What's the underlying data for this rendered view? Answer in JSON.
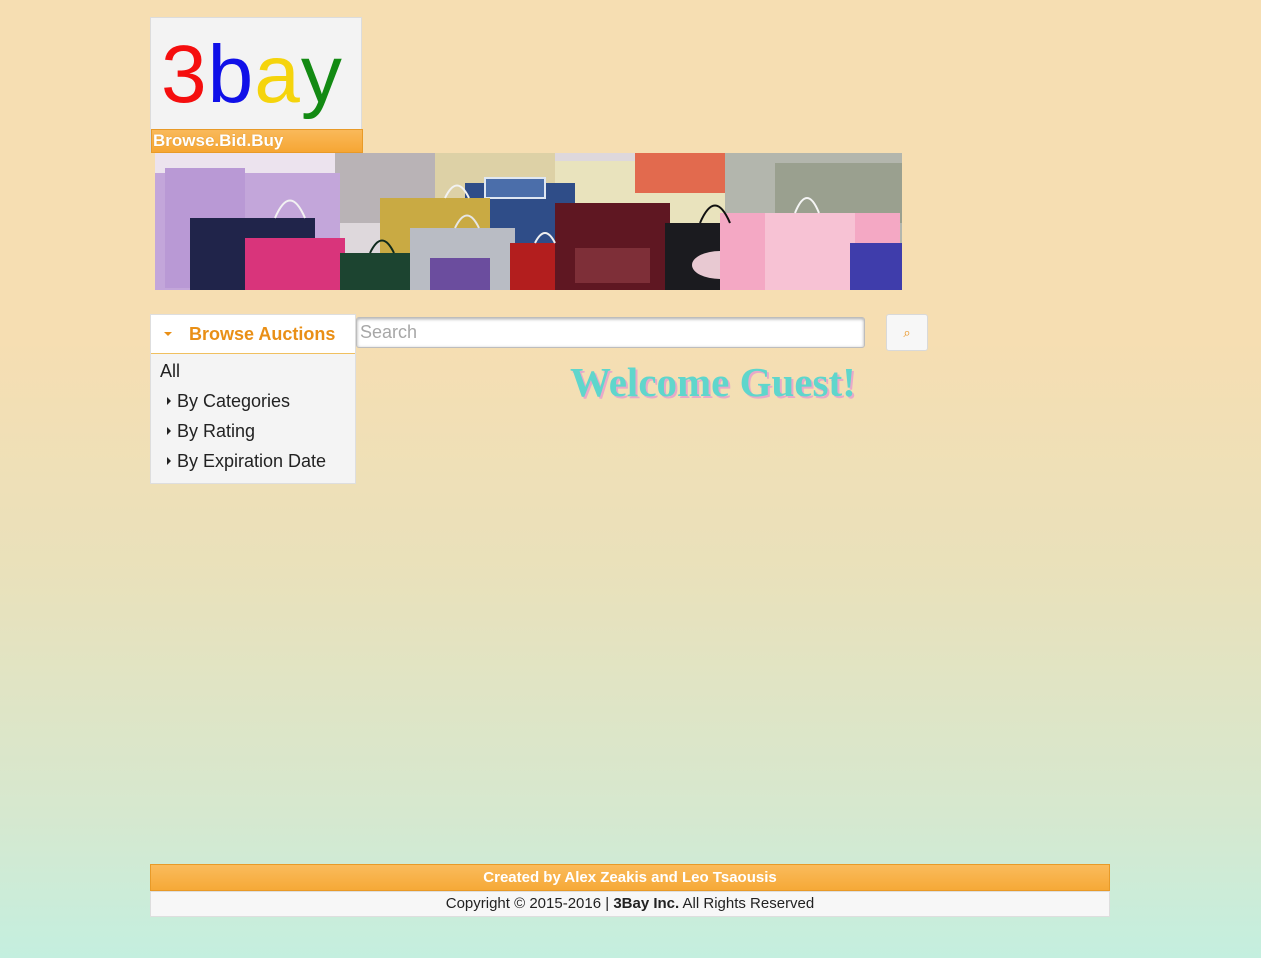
{
  "logo": {
    "letters": [
      {
        "char": "3",
        "color": "#f50e0e"
      },
      {
        "char": "b",
        "color": "#1010e8"
      },
      {
        "char": "a",
        "color": "#f5d40c"
      },
      {
        "char": "y",
        "color": "#138a13"
      }
    ],
    "tagline": "Browse.Bid.Buy"
  },
  "banner": {
    "image_subject": "colorful shopping bags"
  },
  "nav": {
    "title": "Browse Auctions",
    "items": [
      {
        "label": "All"
      },
      {
        "label": "By Categories"
      },
      {
        "label": "By Rating"
      },
      {
        "label": "By Expiration Date"
      }
    ]
  },
  "search": {
    "placeholder": "Search",
    "value": "",
    "button_icon": "search-icon",
    "button_glyph": "⌕"
  },
  "welcome": {
    "text": "Welcome Guest!"
  },
  "footer": {
    "credits": "Created by Alex Zeakis and Leo Tsaousis",
    "copyright_prefix": "Copyright © 2015-2016 | ",
    "company": "3Bay Inc.",
    "rights": " All Rights Reserved"
  },
  "colors": {
    "accent_orange": "#f6a634",
    "nav_title": "#e98f16",
    "welcome_text": "#5fd6cc",
    "welcome_shadow": "#e8a9c8"
  }
}
